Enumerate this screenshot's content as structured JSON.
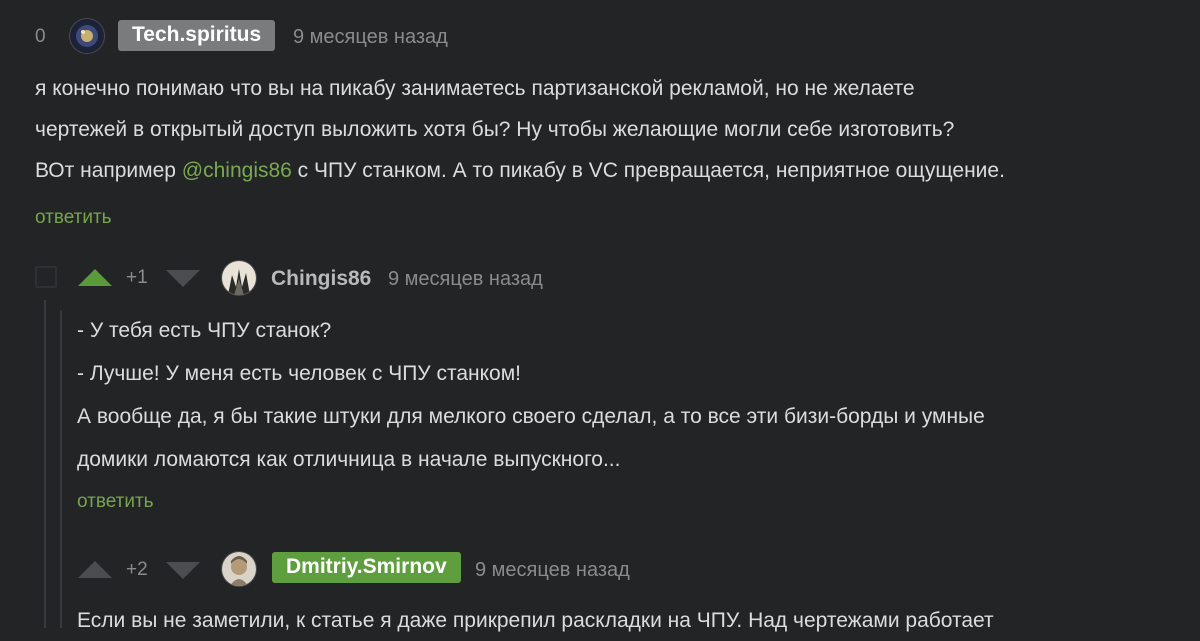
{
  "comments": [
    {
      "rating": "0",
      "username": "Tech.spiritus",
      "time": "9 месяцев назад",
      "text_lines": [
        "я конечно понимаю что вы на пикабу занимаетесь партизанской рекламой, но не желаете",
        "чертежей в открытый доступ выложить хотя бы? Ну чтобы желающие могли себе изготовить?"
      ],
      "line3_before": "ВОт например ",
      "mention": "@chingis86",
      "line3_after": " с ЧПУ станком. А то пикабу в VC превращается, неприятное ощущение.",
      "reply_label": "ответить"
    },
    {
      "rating": "+1",
      "username": "Chingis86",
      "time": "9 месяцев назад",
      "text_lines": [
        "- У тебя есть ЧПУ станок?",
        "- Лучше! У меня есть человек с ЧПУ станком!",
        "А вообще да, я бы такие штуки для мелкого своего сделал, а то все эти бизи-борды и умные",
        "домики ломаются как отличница в начале выпускного..."
      ],
      "reply_label": "ответить"
    },
    {
      "rating": "+2",
      "username": "Dmitriy.Smirnov",
      "time": "9 месяцев назад",
      "text_lines": [
        "Если вы не заметили, к статье я даже прикрепил раскладки на ЧПУ. Над чертежами работает"
      ]
    }
  ],
  "colors": {
    "background": "#232426",
    "accent_green": "#5f9e3f",
    "link_green": "#76a54b",
    "muted_gray": "#8b8b8b"
  },
  "icons": [
    "upvote-arrow-icon",
    "downvote-arrow-icon",
    "avatar-image"
  ]
}
